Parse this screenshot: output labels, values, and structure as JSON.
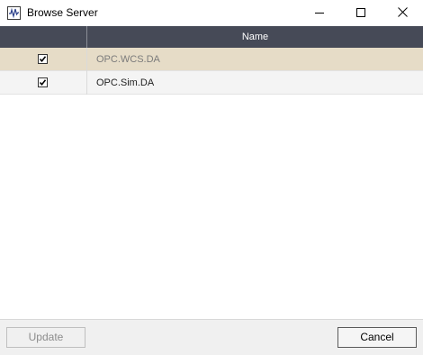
{
  "window": {
    "title": "Browse Server"
  },
  "grid": {
    "columns": [
      "",
      "Name"
    ],
    "rows": [
      {
        "checked": true,
        "name": "OPC.WCS.DA",
        "selected": true
      },
      {
        "checked": true,
        "name": "OPC.Sim.DA",
        "selected": false
      }
    ]
  },
  "footer": {
    "update_label": "Update",
    "cancel_label": "Cancel"
  },
  "colors": {
    "header_bg": "#464a57",
    "selected_row_bg": "#e6dcc7"
  },
  "icons": {
    "app": "waveform-icon",
    "minimize": "minimize-icon",
    "maximize": "maximize-icon",
    "close": "close-icon",
    "check": "checkmark-icon"
  }
}
